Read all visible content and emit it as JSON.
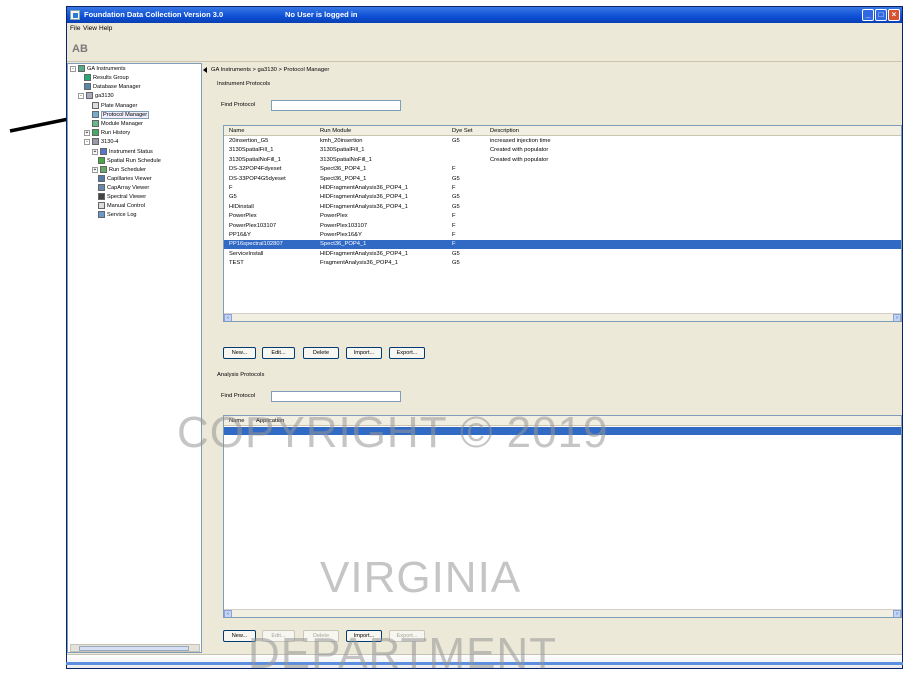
{
  "window": {
    "title": "Foundation Data Collection Version 3.0",
    "user_status": "No User is logged in"
  },
  "menu": [
    "File",
    "View",
    "Help"
  ],
  "logo": "AB",
  "tree": {
    "items": [
      {
        "label": "GA Instruments",
        "exp": "-"
      },
      {
        "label": "Results Group",
        "exp": ""
      },
      {
        "label": "Database Manager",
        "exp": ""
      },
      {
        "label": "ga3130",
        "exp": "-"
      },
      {
        "label": "Plate Manager",
        "exp": ""
      },
      {
        "label": "Protocol Manager",
        "exp": ""
      },
      {
        "label": "Module Manager",
        "exp": ""
      },
      {
        "label": "Run History",
        "exp": "+"
      },
      {
        "label": "3130-4",
        "exp": "-"
      },
      {
        "label": "Instrument Status",
        "exp": "+"
      },
      {
        "label": "Spatial Run Schedule",
        "exp": ""
      },
      {
        "label": "Run Scheduler",
        "exp": "+"
      },
      {
        "label": "Capillaries Viewer",
        "exp": ""
      },
      {
        "label": "CapArray Viewer",
        "exp": ""
      },
      {
        "label": "Spectral Viewer",
        "exp": ""
      },
      {
        "label": "Manual Control",
        "exp": ""
      },
      {
        "label": "Service Log",
        "exp": ""
      }
    ]
  },
  "breadcrumb": "GA Instruments > ga3130 > Protocol Manager",
  "instrument_protocols": {
    "section_label": "Instrument Protocols",
    "find_label": "Find Protocol",
    "find_value": "",
    "columns": [
      "Name",
      "Run Module",
      "Dye Set",
      "Description"
    ],
    "rows": [
      [
        "20insertion_G5",
        "kmh_20insertion",
        "G5",
        "increased injection time"
      ],
      [
        "3130SpatialFill_1",
        "3130SpatialFill_1",
        "",
        "Created with populator"
      ],
      [
        "3130SpatialNoFill_1",
        "3130SpatialNoFill_1",
        "",
        "Created with populator"
      ],
      [
        "DS-32POP4Fdyeset",
        "Spect36_POP4_1",
        "F",
        ""
      ],
      [
        "DS-33POP4G5dyeset",
        "Spect36_POP4_1",
        "G5",
        ""
      ],
      [
        "F",
        "HIDFragmentAnalysis36_POP4_1",
        "F",
        ""
      ],
      [
        "G5",
        "HIDFragmentAnalysis36_POP4_1",
        "G5",
        ""
      ],
      [
        "HIDinstall",
        "HIDFragmentAnalysis36_POP4_1",
        "G5",
        ""
      ],
      [
        "PowerPlex",
        "PowerPlex",
        "F",
        ""
      ],
      [
        "PowerPlex103107",
        "PowerPlex103107",
        "F",
        ""
      ],
      [
        "PP16&Y",
        "PowerPlex16&Y",
        "F",
        ""
      ],
      [
        "PP16spectral102807",
        "Spect36_POP4_1",
        "F",
        ""
      ],
      [
        "ServiceInstall",
        "HIDFragmentAnalysis36_POP4_1",
        "G5",
        ""
      ],
      [
        "TEST",
        "FragmentAnalysis36_POP4_1",
        "G5",
        ""
      ]
    ],
    "selected_index": 11,
    "buttons": [
      "New...",
      "Edit...",
      "Delete",
      "Import...",
      "Export..."
    ]
  },
  "analysis_protocols": {
    "section_label": "Analysis Protocols",
    "find_label": "Find Protocol",
    "find_value": "",
    "columns": [
      "Name",
      "Application"
    ],
    "buttons": [
      "New...",
      "Edit...",
      "Delete",
      "Import...",
      "Export..."
    ]
  },
  "watermark": {
    "line1": "COPYRIGHT © 2019",
    "line2": "VIRGINIA",
    "line3": "DEPARTMENT"
  },
  "colors": {
    "selection": "#316ac5",
    "titlebar": "#0c4fd6",
    "window_bg": "#ece9d8"
  }
}
